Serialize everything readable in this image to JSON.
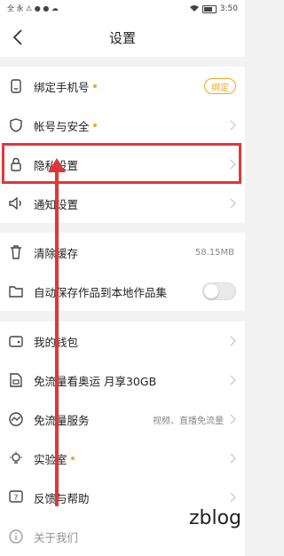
{
  "status_bar": {
    "left": "全 永 ⚠ ● ● ☁",
    "time": "3:50"
  },
  "header": {
    "title": "设置"
  },
  "account_group": [
    {
      "id": "bind-phone",
      "label": "绑定手机号",
      "icon": "phone-icon",
      "dot": true,
      "action_label": "绑定"
    },
    {
      "id": "account-security",
      "label": "帐号与安全",
      "icon": "shield-icon",
      "dot": true
    },
    {
      "id": "privacy-settings",
      "label": "隐私设置",
      "icon": "lock-icon",
      "dot": false
    },
    {
      "id": "notification-settings",
      "label": "通知设置",
      "icon": "speaker-icon",
      "dot": false
    }
  ],
  "storage_group": [
    {
      "id": "clear-cache",
      "label": "清除缓存",
      "icon": "trash-icon",
      "value": "58.15MB"
    },
    {
      "id": "auto-save",
      "label": "自动保存作品到本地作品集",
      "icon": "folder-icon",
      "toggle_on": false
    }
  ],
  "more_group": [
    {
      "id": "wallet",
      "label": "我的钱包",
      "icon": "wallet-icon",
      "dot": false
    },
    {
      "id": "free-data-olympics",
      "label": "免流量看奥运 月享30GB",
      "icon": "sim-icon",
      "dot": false
    },
    {
      "id": "free-data-service",
      "label": "免流量服务",
      "icon": "chart-icon",
      "value": "视频、直播免流量"
    },
    {
      "id": "lab",
      "label": "实验室",
      "icon": "bulb-icon",
      "dot": true
    },
    {
      "id": "feedback-help",
      "label": "反馈与帮助",
      "icon": "help-icon",
      "dot": false
    },
    {
      "id": "about",
      "label": "关于我们",
      "icon": "info-icon",
      "dot": false
    }
  ],
  "annotation": {
    "color": "#e0363a"
  },
  "accent_color": "#f5a623",
  "watermark": "zblog"
}
